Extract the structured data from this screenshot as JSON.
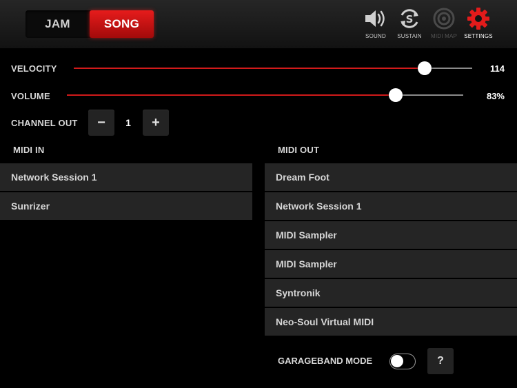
{
  "header": {
    "mode_jam": "JAM",
    "mode_song": "SONG",
    "active_mode": "SONG",
    "tools": [
      {
        "label": "SOUND",
        "icon": "speaker-icon",
        "state": "normal"
      },
      {
        "label": "SUSTAIN",
        "icon": "sustain-icon",
        "state": "normal"
      },
      {
        "label": "MIDI MAP",
        "icon": "target-icon",
        "state": "disabled"
      },
      {
        "label": "SETTINGS",
        "icon": "gear-icon",
        "state": "active"
      }
    ]
  },
  "velocity": {
    "label": "VELOCITY",
    "value": "114",
    "fraction": 0.88
  },
  "volume": {
    "label": "VOLUME",
    "value": "83%",
    "fraction": 0.83
  },
  "channel_out": {
    "label": "CHANNEL OUT",
    "minus": "−",
    "value": "1",
    "plus": "+"
  },
  "midi_in": {
    "title": "MIDI IN",
    "items": [
      "Network Session 1",
      "Sunrizer"
    ]
  },
  "midi_out": {
    "title": "MIDI OUT",
    "items": [
      "Dream Foot",
      "Network Session 1",
      "MIDI Sampler",
      "MIDI Sampler",
      "Syntronik",
      "Neo-Soul Virtual MIDI"
    ]
  },
  "garageband": {
    "label": "GARAGEBAND MODE",
    "enabled": false,
    "help": "?"
  },
  "colors": {
    "accent": "#d11a1a",
    "background": "#000000",
    "panel": "#252525"
  }
}
